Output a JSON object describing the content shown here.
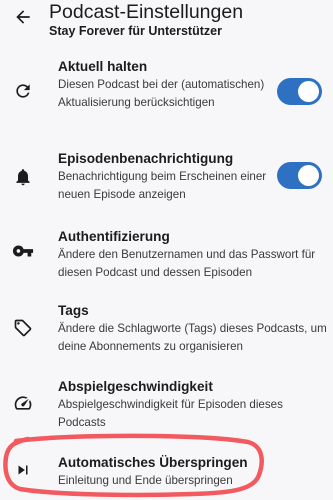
{
  "header": {
    "back_icon": "arrow-left-icon",
    "title": "Podcast-Einstellungen",
    "subtitle": "Stay Forever für Unterstützer"
  },
  "settings": [
    {
      "icon": "refresh-icon",
      "title": "Aktuell halten",
      "summary": "Diesen Podcast bei der (automatischen) Aktualisierung berücksichtigen",
      "toggle": true
    },
    {
      "icon": "bell-icon",
      "title": "Episodenbenachrichtigung",
      "summary": "Benachrichtigung beim Erscheinen einer neuen Episode anzeigen",
      "toggle": true
    },
    {
      "icon": "key-icon",
      "title": "Authentifizierung",
      "summary": "Ändere den Benutzernamen und das Passwort für diesen Podcast und dessen Episoden"
    },
    {
      "icon": "tag-icon",
      "title": "Tags",
      "summary": "Ändere die Schlagworte (Tags) dieses Podcasts, um deine Abonnements zu organisieren"
    },
    {
      "icon": "speedometer-icon",
      "title": "Abspielgeschwindigkeit",
      "summary": "Abspielgeschwindigkeit für Episoden dieses Podcasts"
    },
    {
      "icon": "skip-next-icon",
      "title": "Automatisches Überspringen",
      "summary": "Einleitung und Ende überspringen"
    }
  ],
  "colors": {
    "accent": "#2e71c3",
    "background": "#f7f7f9",
    "annotation": "#f25a5f"
  }
}
